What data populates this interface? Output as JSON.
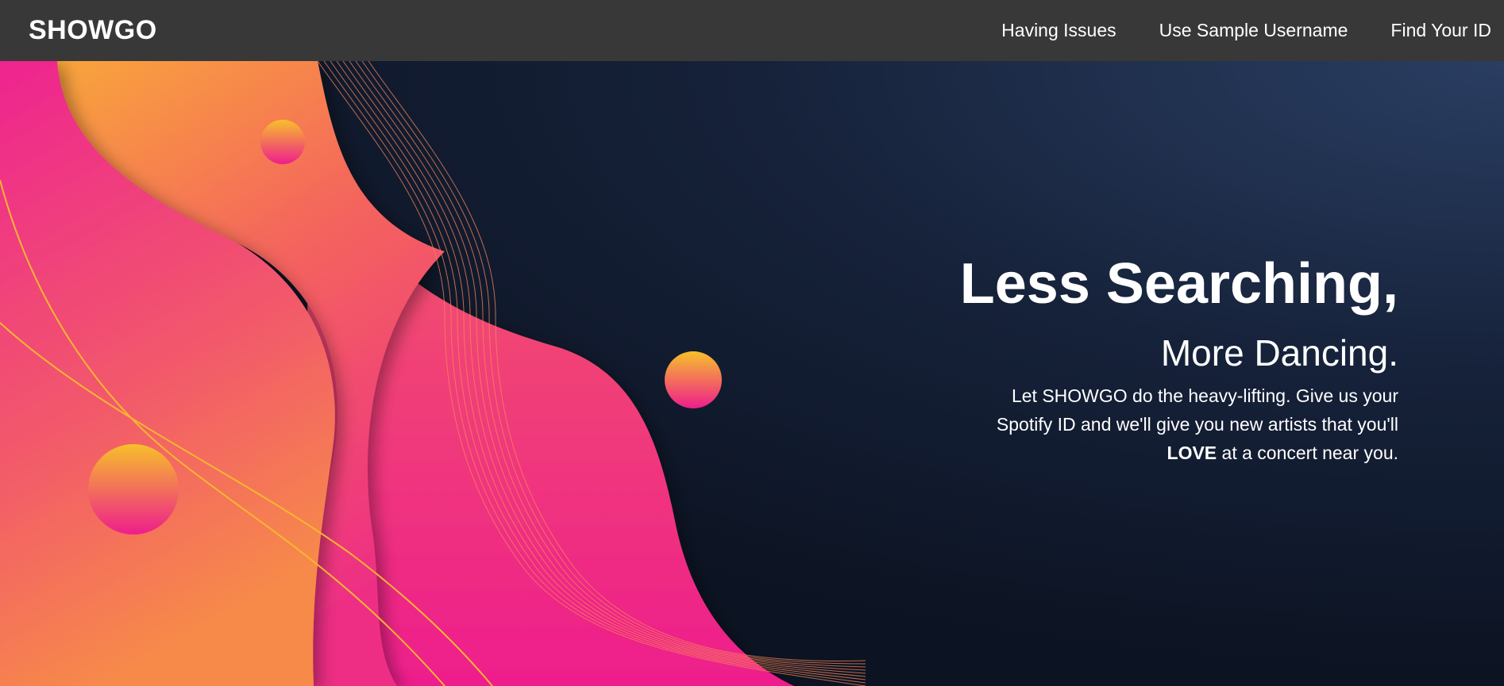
{
  "navbar": {
    "brand": "SHOWGO",
    "links": [
      {
        "label": "Having Issues"
      },
      {
        "label": "Use Sample Username"
      },
      {
        "label": "Find Your ID"
      }
    ]
  },
  "hero": {
    "headline": "Less Searching,",
    "subheadline": "More Dancing.",
    "description_before": "Let SHOWGO do the heavy-lifting. Give us your Spotify ID and we'll give you new artists that you'll",
    "description_emphasis": "LOVE",
    "description_after": "at a concert near you."
  },
  "colors": {
    "navbar_bg": "#383838",
    "background_dark": "#0c1322",
    "background_light": "#2a3e62",
    "pink": "#ee1f8a",
    "orange": "#f9a23a",
    "yellow": "#f7c02a"
  }
}
